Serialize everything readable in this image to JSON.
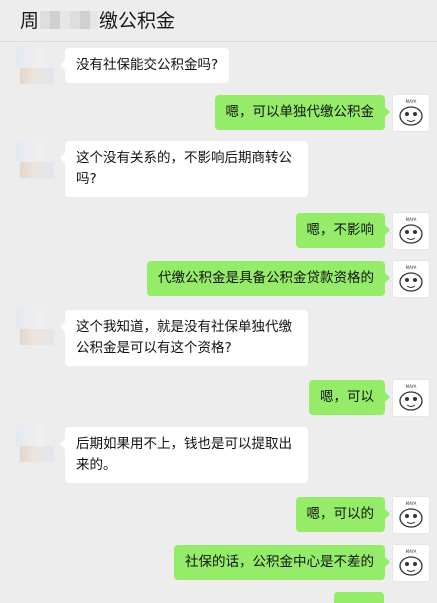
{
  "header": {
    "title_prefix": "周",
    "title_suffix": "缴公积金"
  },
  "messages": [
    {
      "side": "left",
      "text": "没有社保能交公积金吗?"
    },
    {
      "side": "right",
      "text": "嗯，可以单独代缴公积金"
    },
    {
      "side": "left",
      "text": "这个没有关系的，不影响后期商转公吗?"
    },
    {
      "side": "right",
      "text": "嗯，不影响"
    },
    {
      "side": "right",
      "text": "代缴公积金是具备公积金贷款资格的"
    },
    {
      "side": "left",
      "text": "这个我知道，就是没有社保单独代缴公积金是可以有这个资格?"
    },
    {
      "side": "right",
      "text": "嗯，可以"
    },
    {
      "side": "left",
      "text": "后期如果用不上，钱也是可以提取出来的。"
    },
    {
      "side": "right",
      "text": "嗯，可以的"
    },
    {
      "side": "right",
      "text": "社保的话，公积金中心是不差的"
    }
  ]
}
